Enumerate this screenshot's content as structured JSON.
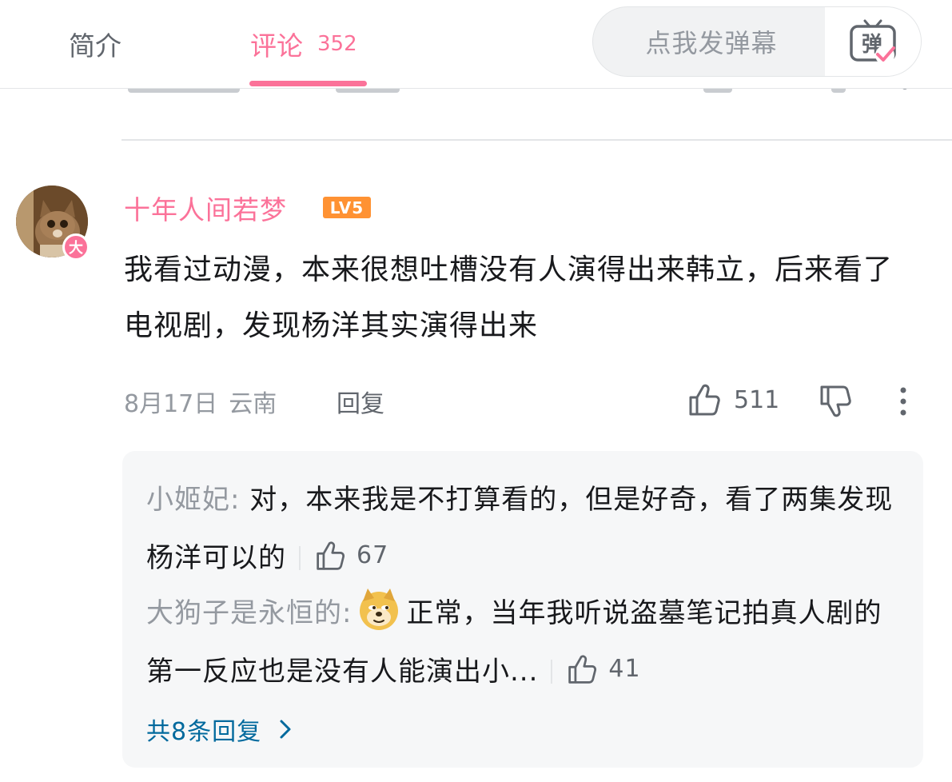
{
  "tabs": {
    "intro_label": "简介",
    "comments_label": "评论",
    "comments_count": "352"
  },
  "danmaku": {
    "placeholder": "点我发弹幕",
    "toggle_icon": "danmaku-toggle-icon",
    "toggle_char": "弹"
  },
  "comment": {
    "username": "十年人间若梦",
    "level": "LV5",
    "avatar_badge": "大",
    "text": "我看过动漫，本来很想吐槽没有人演得出来韩立，后来看了电视剧，发现杨洋其实演得出来",
    "date": "8月17日",
    "region": "云南",
    "reply_label": "回复",
    "like_count": "511"
  },
  "replies": {
    "items": [
      {
        "name": "小姬妃",
        "text": "对，本来我是不打算看的，但是好奇，看了两集发现杨洋可以的",
        "likes": "67"
      },
      {
        "name": "大狗子是永恒的",
        "emoji": "doge-emoji",
        "text": "正常，当年我听说盗墓笔记拍真人剧的第一反应也是没有人能演出小...",
        "likes": "41"
      }
    ],
    "more_label": "共8条回复"
  },
  "colors": {
    "accent_pink": "#fb7299",
    "level_orange": "#ff9233",
    "link_blue": "#00699d",
    "gray_text": "#9499a0",
    "reply_bg": "#f6f7f8"
  }
}
